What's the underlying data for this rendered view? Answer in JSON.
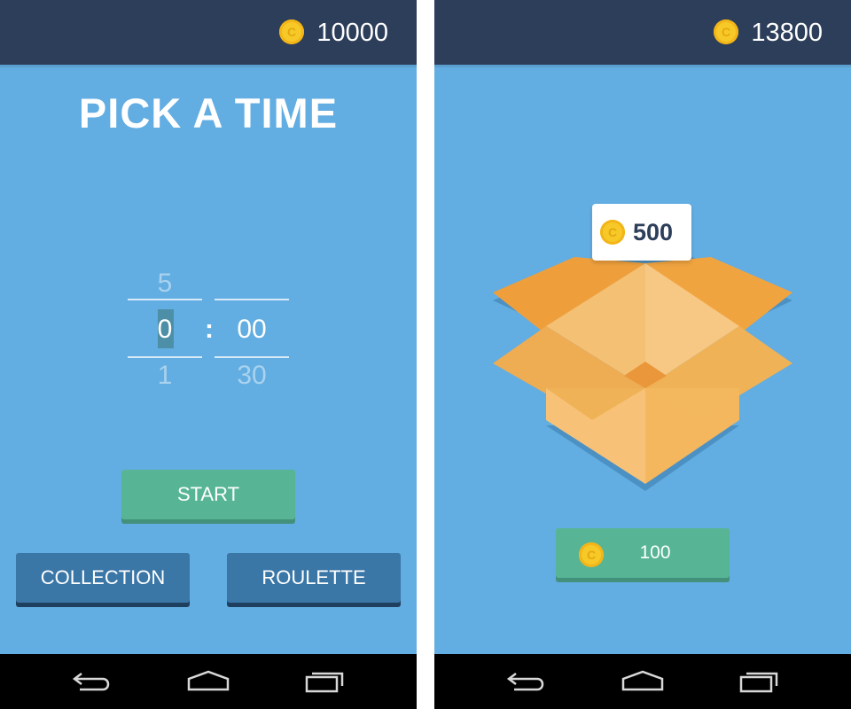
{
  "left_screen": {
    "balance": "10000",
    "title": "PICK A TIME",
    "picker": {
      "hours_prev": "5",
      "hours_current": "0",
      "hours_next": "1",
      "separator": ":",
      "minutes_current": "00",
      "minutes_next": "30"
    },
    "buttons": {
      "start": "START",
      "collection": "COLLECTION",
      "roulette": "ROULETTE"
    }
  },
  "right_screen": {
    "balance": "13800",
    "reward_amount": "500",
    "buy_price": "100"
  },
  "icons": {
    "coin": "coin-icon",
    "back": "back-icon",
    "home": "home-icon",
    "recents": "recent-apps-icon",
    "box": "open-box-illustration"
  },
  "colors": {
    "background": "#62ade1",
    "topbar": "#2c3e59",
    "green_button": "#57b596",
    "blue_button": "#3a76a6",
    "coin": "#f6c928",
    "box": "#f2a94a"
  }
}
